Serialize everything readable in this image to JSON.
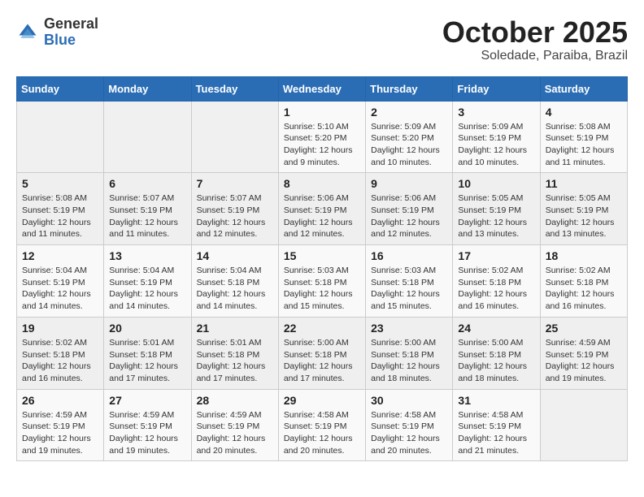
{
  "header": {
    "logo_general": "General",
    "logo_blue": "Blue",
    "month_year": "October 2025",
    "location": "Soledade, Paraiba, Brazil"
  },
  "weekdays": [
    "Sunday",
    "Monday",
    "Tuesday",
    "Wednesday",
    "Thursday",
    "Friday",
    "Saturday"
  ],
  "weeks": [
    [
      {
        "day": "",
        "info": ""
      },
      {
        "day": "",
        "info": ""
      },
      {
        "day": "",
        "info": ""
      },
      {
        "day": "1",
        "info": "Sunrise: 5:10 AM\nSunset: 5:20 PM\nDaylight: 12 hours\nand 9 minutes."
      },
      {
        "day": "2",
        "info": "Sunrise: 5:09 AM\nSunset: 5:20 PM\nDaylight: 12 hours\nand 10 minutes."
      },
      {
        "day": "3",
        "info": "Sunrise: 5:09 AM\nSunset: 5:19 PM\nDaylight: 12 hours\nand 10 minutes."
      },
      {
        "day": "4",
        "info": "Sunrise: 5:08 AM\nSunset: 5:19 PM\nDaylight: 12 hours\nand 11 minutes."
      }
    ],
    [
      {
        "day": "5",
        "info": "Sunrise: 5:08 AM\nSunset: 5:19 PM\nDaylight: 12 hours\nand 11 minutes."
      },
      {
        "day": "6",
        "info": "Sunrise: 5:07 AM\nSunset: 5:19 PM\nDaylight: 12 hours\nand 11 minutes."
      },
      {
        "day": "7",
        "info": "Sunrise: 5:07 AM\nSunset: 5:19 PM\nDaylight: 12 hours\nand 12 minutes."
      },
      {
        "day": "8",
        "info": "Sunrise: 5:06 AM\nSunset: 5:19 PM\nDaylight: 12 hours\nand 12 minutes."
      },
      {
        "day": "9",
        "info": "Sunrise: 5:06 AM\nSunset: 5:19 PM\nDaylight: 12 hours\nand 12 minutes."
      },
      {
        "day": "10",
        "info": "Sunrise: 5:05 AM\nSunset: 5:19 PM\nDaylight: 12 hours\nand 13 minutes."
      },
      {
        "day": "11",
        "info": "Sunrise: 5:05 AM\nSunset: 5:19 PM\nDaylight: 12 hours\nand 13 minutes."
      }
    ],
    [
      {
        "day": "12",
        "info": "Sunrise: 5:04 AM\nSunset: 5:19 PM\nDaylight: 12 hours\nand 14 minutes."
      },
      {
        "day": "13",
        "info": "Sunrise: 5:04 AM\nSunset: 5:19 PM\nDaylight: 12 hours\nand 14 minutes."
      },
      {
        "day": "14",
        "info": "Sunrise: 5:04 AM\nSunset: 5:18 PM\nDaylight: 12 hours\nand 14 minutes."
      },
      {
        "day": "15",
        "info": "Sunrise: 5:03 AM\nSunset: 5:18 PM\nDaylight: 12 hours\nand 15 minutes."
      },
      {
        "day": "16",
        "info": "Sunrise: 5:03 AM\nSunset: 5:18 PM\nDaylight: 12 hours\nand 15 minutes."
      },
      {
        "day": "17",
        "info": "Sunrise: 5:02 AM\nSunset: 5:18 PM\nDaylight: 12 hours\nand 16 minutes."
      },
      {
        "day": "18",
        "info": "Sunrise: 5:02 AM\nSunset: 5:18 PM\nDaylight: 12 hours\nand 16 minutes."
      }
    ],
    [
      {
        "day": "19",
        "info": "Sunrise: 5:02 AM\nSunset: 5:18 PM\nDaylight: 12 hours\nand 16 minutes."
      },
      {
        "day": "20",
        "info": "Sunrise: 5:01 AM\nSunset: 5:18 PM\nDaylight: 12 hours\nand 17 minutes."
      },
      {
        "day": "21",
        "info": "Sunrise: 5:01 AM\nSunset: 5:18 PM\nDaylight: 12 hours\nand 17 minutes."
      },
      {
        "day": "22",
        "info": "Sunrise: 5:00 AM\nSunset: 5:18 PM\nDaylight: 12 hours\nand 17 minutes."
      },
      {
        "day": "23",
        "info": "Sunrise: 5:00 AM\nSunset: 5:18 PM\nDaylight: 12 hours\nand 18 minutes."
      },
      {
        "day": "24",
        "info": "Sunrise: 5:00 AM\nSunset: 5:18 PM\nDaylight: 12 hours\nand 18 minutes."
      },
      {
        "day": "25",
        "info": "Sunrise: 4:59 AM\nSunset: 5:19 PM\nDaylight: 12 hours\nand 19 minutes."
      }
    ],
    [
      {
        "day": "26",
        "info": "Sunrise: 4:59 AM\nSunset: 5:19 PM\nDaylight: 12 hours\nand 19 minutes."
      },
      {
        "day": "27",
        "info": "Sunrise: 4:59 AM\nSunset: 5:19 PM\nDaylight: 12 hours\nand 19 minutes."
      },
      {
        "day": "28",
        "info": "Sunrise: 4:59 AM\nSunset: 5:19 PM\nDaylight: 12 hours\nand 20 minutes."
      },
      {
        "day": "29",
        "info": "Sunrise: 4:58 AM\nSunset: 5:19 PM\nDaylight: 12 hours\nand 20 minutes."
      },
      {
        "day": "30",
        "info": "Sunrise: 4:58 AM\nSunset: 5:19 PM\nDaylight: 12 hours\nand 20 minutes."
      },
      {
        "day": "31",
        "info": "Sunrise: 4:58 AM\nSunset: 5:19 PM\nDaylight: 12 hours\nand 21 minutes."
      },
      {
        "day": "",
        "info": ""
      }
    ]
  ]
}
